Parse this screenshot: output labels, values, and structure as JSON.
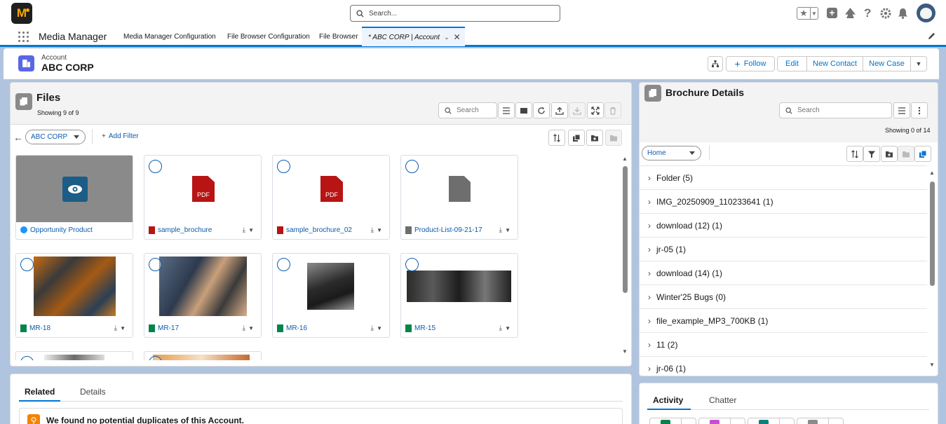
{
  "app": {
    "logo_text": "M",
    "name": "Media Manager"
  },
  "global_search": {
    "placeholder": "Search..."
  },
  "nav_tabs": [
    {
      "label": "Media Manager Configuration"
    },
    {
      "label": "File Browser Configuration"
    },
    {
      "label": "File Browser"
    },
    {
      "label": "* ABC CORP | Account",
      "active": true
    }
  ],
  "record": {
    "object": "Account",
    "name": "ABC CORP"
  },
  "header_actions": {
    "follow": "Follow",
    "edit": "Edit",
    "new_contact": "New Contact",
    "new_case": "New Case"
  },
  "files": {
    "title": "Files",
    "showing": "Showing 9 of 9",
    "search_placeholder": "Search",
    "filter_value": "ABC CORP",
    "add_filter": "Add Filter",
    "tiles": [
      {
        "name": "Opportunity Product",
        "kind": "preview",
        "color": "#8a8a8a"
      },
      {
        "name": "sample_brochure",
        "kind": "pdf"
      },
      {
        "name": "sample_brochure_02",
        "kind": "pdf"
      },
      {
        "name": "Product-List-09-21-17",
        "kind": "doc"
      },
      {
        "name": "MR-18",
        "kind": "photo"
      },
      {
        "name": "MR-17",
        "kind": "photo"
      },
      {
        "name": "MR-16",
        "kind": "photo"
      },
      {
        "name": "MR-15",
        "kind": "photo"
      }
    ],
    "pdf_label": "PDF"
  },
  "brochure": {
    "title": "Brochure Details",
    "search_placeholder": "Search",
    "showing": "Showing 0 of 14",
    "folder_select": "Home",
    "folders": [
      {
        "label": "Folder (5)"
      },
      {
        "label": "IMG_20250909_110233641 (1)"
      },
      {
        "label": "download (12) (1)"
      },
      {
        "label": "jr-05 (1)"
      },
      {
        "label": "download (14) (1)"
      },
      {
        "label": "Winter'25 Bugs (0)"
      },
      {
        "label": "file_example_MP3_700KB (1)"
      },
      {
        "label": "11 (2)"
      },
      {
        "label": "jr-06 (1)"
      }
    ]
  },
  "related_tabs": {
    "related": "Related",
    "details": "Details"
  },
  "duplicates_msg": "We found no potential duplicates of this Account.",
  "activity_tabs": {
    "activity": "Activity",
    "chatter": "Chatter"
  },
  "colors": {
    "brand": "#0176d3",
    "accent_orange": "#f38303",
    "pdf_red": "#b81414"
  }
}
